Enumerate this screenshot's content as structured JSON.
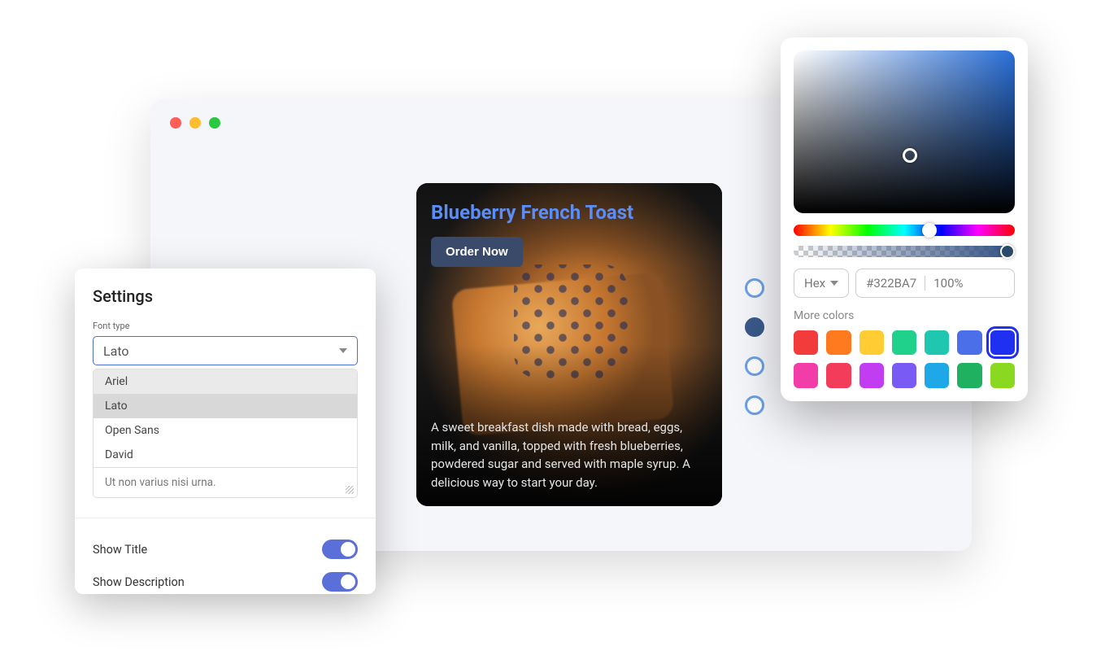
{
  "browser": {
    "traffic": [
      "red",
      "yellow",
      "green"
    ]
  },
  "recipe": {
    "title": "Blueberry French Toast",
    "button_label": "Order Now",
    "description": "A sweet breakfast dish made with bread, eggs, milk, and vanilla, topped with fresh blueberries, powdered sugar and served with maple syrup. A delicious way to start your day."
  },
  "nav_circles": [
    {
      "filled": false
    },
    {
      "filled": true
    },
    {
      "filled": false
    },
    {
      "filled": false
    }
  ],
  "settings": {
    "title": "Settings",
    "font_type_label": "Font type",
    "selected_font": "Lato",
    "font_options": [
      "Ariel",
      "Lato",
      "Open Sans",
      "David"
    ],
    "textarea_value": "Ut non varius nisi urna.",
    "toggles": [
      {
        "label": "Show Title",
        "on": true
      },
      {
        "label": "Show Description",
        "on": true
      }
    ]
  },
  "color_picker": {
    "format_label": "Hex",
    "hex_value": "#322BA7",
    "opacity_label": "100%",
    "more_colors_label": "More colors",
    "swatches_row1": [
      "#f23c3c",
      "#ff7a1f",
      "#ffcc33",
      "#1fd18a",
      "#1fc7b0",
      "#4a6fe8",
      "#2030f0"
    ],
    "swatches_row2": [
      "#f23ca8",
      "#f23c5a",
      "#c23cf2",
      "#7a5af5",
      "#1fa8e8",
      "#1fb060",
      "#8ad81f"
    ],
    "selected_swatch_index": 6
  }
}
